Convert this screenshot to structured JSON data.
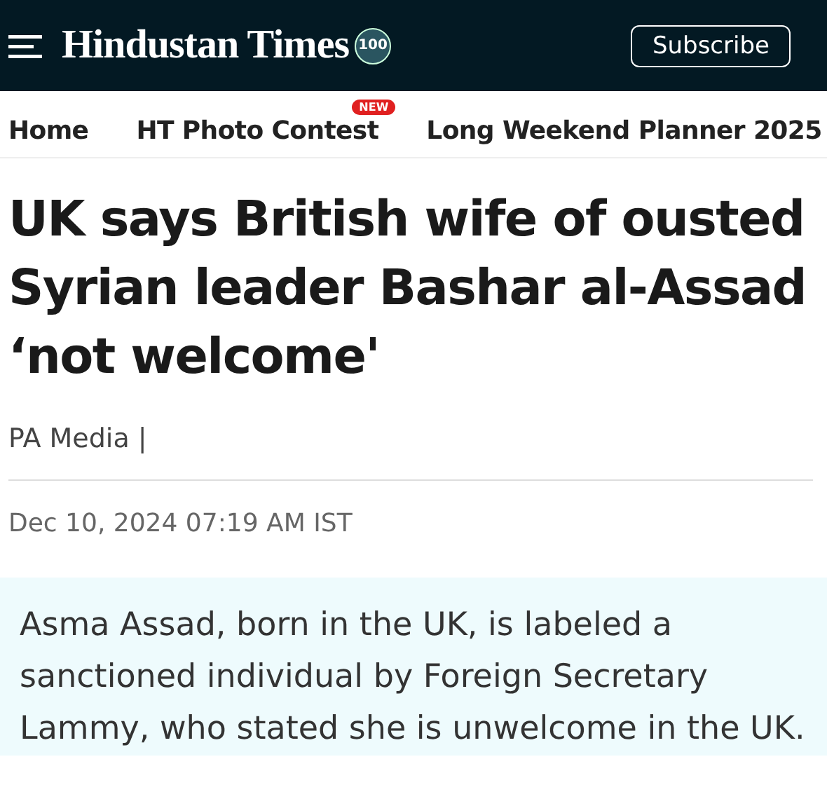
{
  "header": {
    "logo": "Hindustan Times",
    "logo_badge": "100",
    "subscribe": "Subscribe"
  },
  "nav": [
    {
      "label": "Home"
    },
    {
      "label": "HT Photo Contest",
      "badge": "NEW"
    },
    {
      "label": "Long Weekend Planner 2025"
    }
  ],
  "article": {
    "headline": "UK says British wife of ousted Syrian leader Bashar al-Assad ‘not welcome'",
    "byline": "PA Media |",
    "date": "Dec 10, 2024 07:19 AM IST",
    "summary": "Asma Assad, born in the UK, is labeled a sanctioned individual by Foreign Secretary Lammy, who stated she is unwelcome in the UK."
  }
}
